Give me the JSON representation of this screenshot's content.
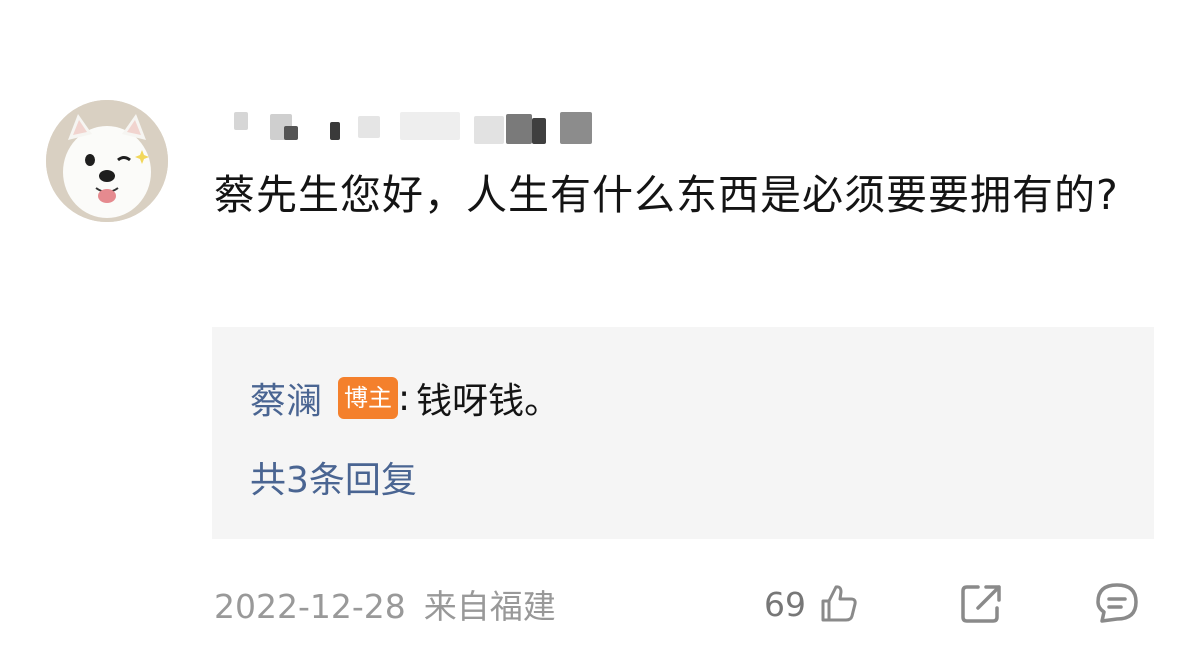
{
  "comment": {
    "text": "蔡先生您好，人生有什么东西是必须要要拥有的?",
    "date": "2022-12-28",
    "location": "来自福建",
    "like_count": "69",
    "avatar_icon": "samoyed-dog-avatar"
  },
  "reply": {
    "author": "蔡澜",
    "badge": "博主",
    "separator": ":",
    "text": "钱呀钱。",
    "more_label": "共3条回复"
  },
  "icons": {
    "like": "thumbs-up-icon",
    "share": "share-icon",
    "comment": "comment-icon"
  },
  "colors": {
    "link": "#4a6592",
    "badge": "#f4802c",
    "reply_bg": "#f5f5f5",
    "meta": "#999999"
  }
}
